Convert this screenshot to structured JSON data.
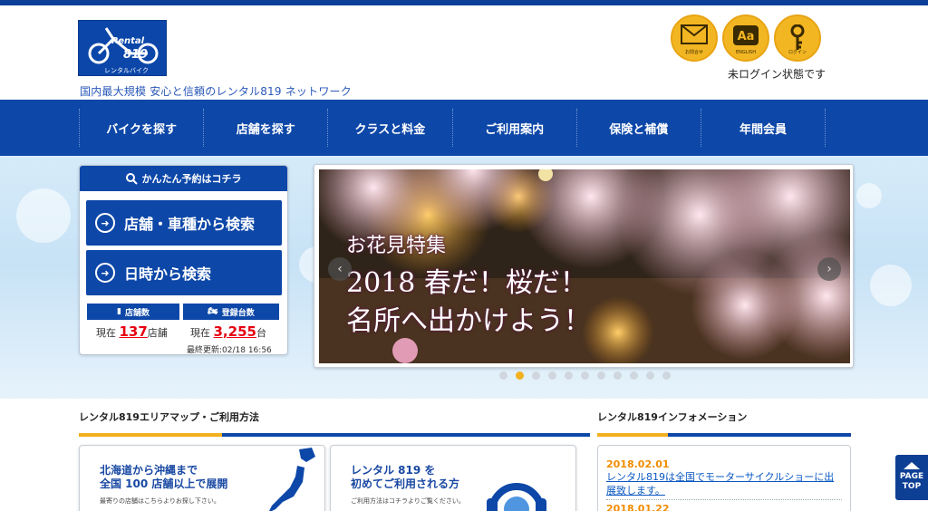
{
  "brand": {
    "logo_text_top": "Rental",
    "logo_text_num": "819",
    "logo_text_sub": "レンタルバイク",
    "tagline": "国内最大規模 安心と信頼のレンタル819 ネットワーク"
  },
  "header_icons": [
    {
      "caption": "お問合せ",
      "icon": "mail-icon"
    },
    {
      "caption": "ENGLISH",
      "icon": "english-icon",
      "glyph": "Aa"
    },
    {
      "caption": "ログイン",
      "icon": "key-icon"
    }
  ],
  "login_state": "未ログイン状態です",
  "nav": [
    "バイクを探す",
    "店舗を探す",
    "クラスと料金",
    "ご利用案内",
    "保険と補償",
    "年間会員"
  ],
  "reserve": {
    "title": "かんたん予約はコチラ",
    "btn_store_vehicle": "店舗・車種から検索",
    "btn_datetime": "日時から検索",
    "stores_label": "店舗数",
    "bikes_label": "登録台数",
    "stores_prefix": "現在",
    "stores_value": "137",
    "stores_suffix": "店舗",
    "bikes_prefix": "現在",
    "bikes_value": "3,255",
    "bikes_suffix": "台",
    "updated": "最終更新:02/18 16:56"
  },
  "slider": {
    "line1": "お花見特集",
    "line2": "2018 春だ！桜だ！",
    "line3": "名所へ出かけよう！",
    "dot_count": 11,
    "active_dot": 1
  },
  "sections": {
    "map_title": "レンタル819エリアマップ・ご利用方法",
    "info_title": "レンタル819インフォメーション"
  },
  "cards": {
    "map_line1": "北海道から沖縄まで",
    "map_line2": "全国 100 店舗以上で展開",
    "map_sub": "最寄りの店舗はこちらよりお探し下さい。",
    "first_line1": "レンタル 819 を",
    "first_line2": "初めてご利用される方",
    "first_sub": "ご利用方法はコチラよりご覧ください。"
  },
  "info": [
    {
      "date": "2018.02.01",
      "text": "レンタル819は全国でモーターサイクルショーに出展致します。"
    },
    {
      "date": "2018.01.22",
      "text": ""
    }
  ],
  "pagetop": {
    "line1": "PAGE",
    "line2": "TOP"
  },
  "colors": {
    "primary": "#0d47a8",
    "accent": "#f2b01e",
    "price": "#e60012",
    "date": "#f08c00"
  }
}
